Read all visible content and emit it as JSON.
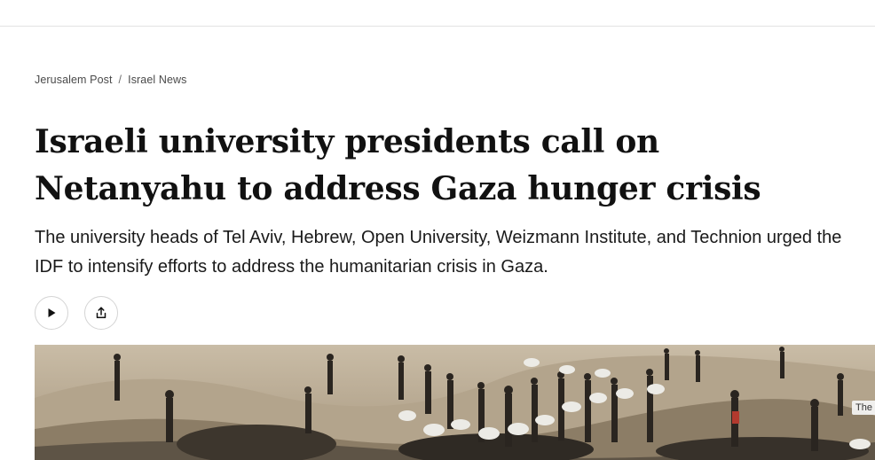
{
  "breadcrumb": {
    "items": [
      "Jerusalem Post",
      "Israel News"
    ],
    "separator": "/"
  },
  "article": {
    "headline": "Israeli university presidents call on Netanyahu to address Gaza hunger crisis",
    "subheadline": "The university heads of Tel Aviv, Hebrew, Open University, Weizmann Institute, and Technion urged the IDF to intensify efforts to address the humanitarian crisis in Gaza."
  },
  "actions": {
    "play_icon": "play-icon",
    "share_icon": "share-icon"
  },
  "hero_image": {
    "caption_tag": "The"
  },
  "colors": {
    "text": "#111111",
    "border": "#d4d4d4",
    "topbar_border": "#e2e2e2"
  }
}
